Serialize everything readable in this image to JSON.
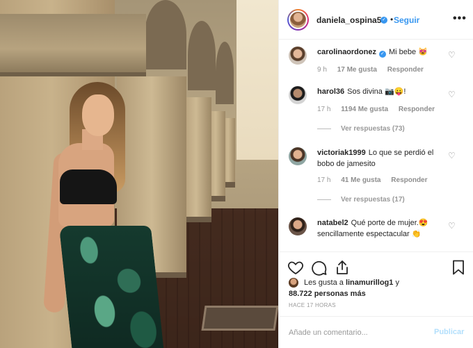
{
  "post": {
    "username": "daniela_ospina5",
    "follow_label": "Seguir",
    "separator": "•"
  },
  "comments": [
    {
      "username": "carolinaordonez",
      "verified": true,
      "text": "Mi bebe 😻",
      "time": "9 h",
      "likes": "17 Me gusta",
      "reply_label": "Responder"
    },
    {
      "username": "harol36",
      "text": "Sos divina 📷😛!",
      "time": "17 h",
      "likes": "1194 Me gusta",
      "reply_label": "Responder",
      "replies": "Ver respuestas (73)"
    },
    {
      "username": "victoriak1999",
      "text": "Lo que se perdió el bobo de jamesito",
      "time": "17 h",
      "likes": "41 Me gusta",
      "reply_label": "Responder",
      "replies": "Ver respuestas (17)"
    },
    {
      "username": "natabel2",
      "text": "Qué porte de mujer.😍 sencillamente espectacular 👏"
    }
  ],
  "likes_summary": {
    "prefix": "Les gusta a",
    "user": "linamurillog1",
    "suffix": "y",
    "count": "88.722 personas más"
  },
  "timestamp": "HACE 17 HORAS",
  "add_comment": {
    "placeholder": "Añade un comentario...",
    "publish_label": "Publicar"
  },
  "colors": {
    "accent": "#3897f0",
    "publish_disabled": "#b2dffc",
    "muted": "#999999"
  },
  "icons": [
    "more-options-icon",
    "verified-badge-icon",
    "heart-icon",
    "comment-icon",
    "share-icon",
    "bookmark-icon"
  ]
}
